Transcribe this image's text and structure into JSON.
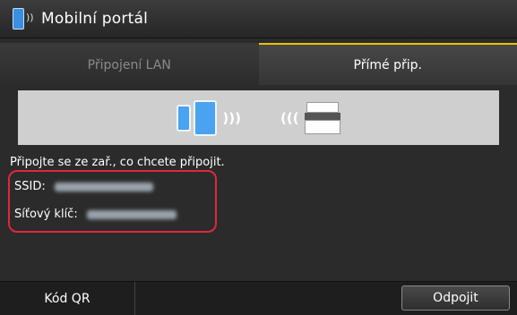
{
  "header": {
    "title": "Mobilní portál",
    "icon": "mobile-portal-icon"
  },
  "tabs": [
    {
      "label": "Připojení LAN",
      "active": false
    },
    {
      "label": "Přímé přip.",
      "active": true
    }
  ],
  "main": {
    "instruction": "Připojte se ze zař., co chcete připojit.",
    "ssid_label": "SSID:",
    "key_label": "Síťový klíč:"
  },
  "footer": {
    "qr_label": "Kód QR",
    "disconnect_label": "Odpojit"
  },
  "colors": {
    "accent_tab": "#e9c300",
    "highlight": "#e0283c",
    "device_blue": "#4aa3f0"
  }
}
